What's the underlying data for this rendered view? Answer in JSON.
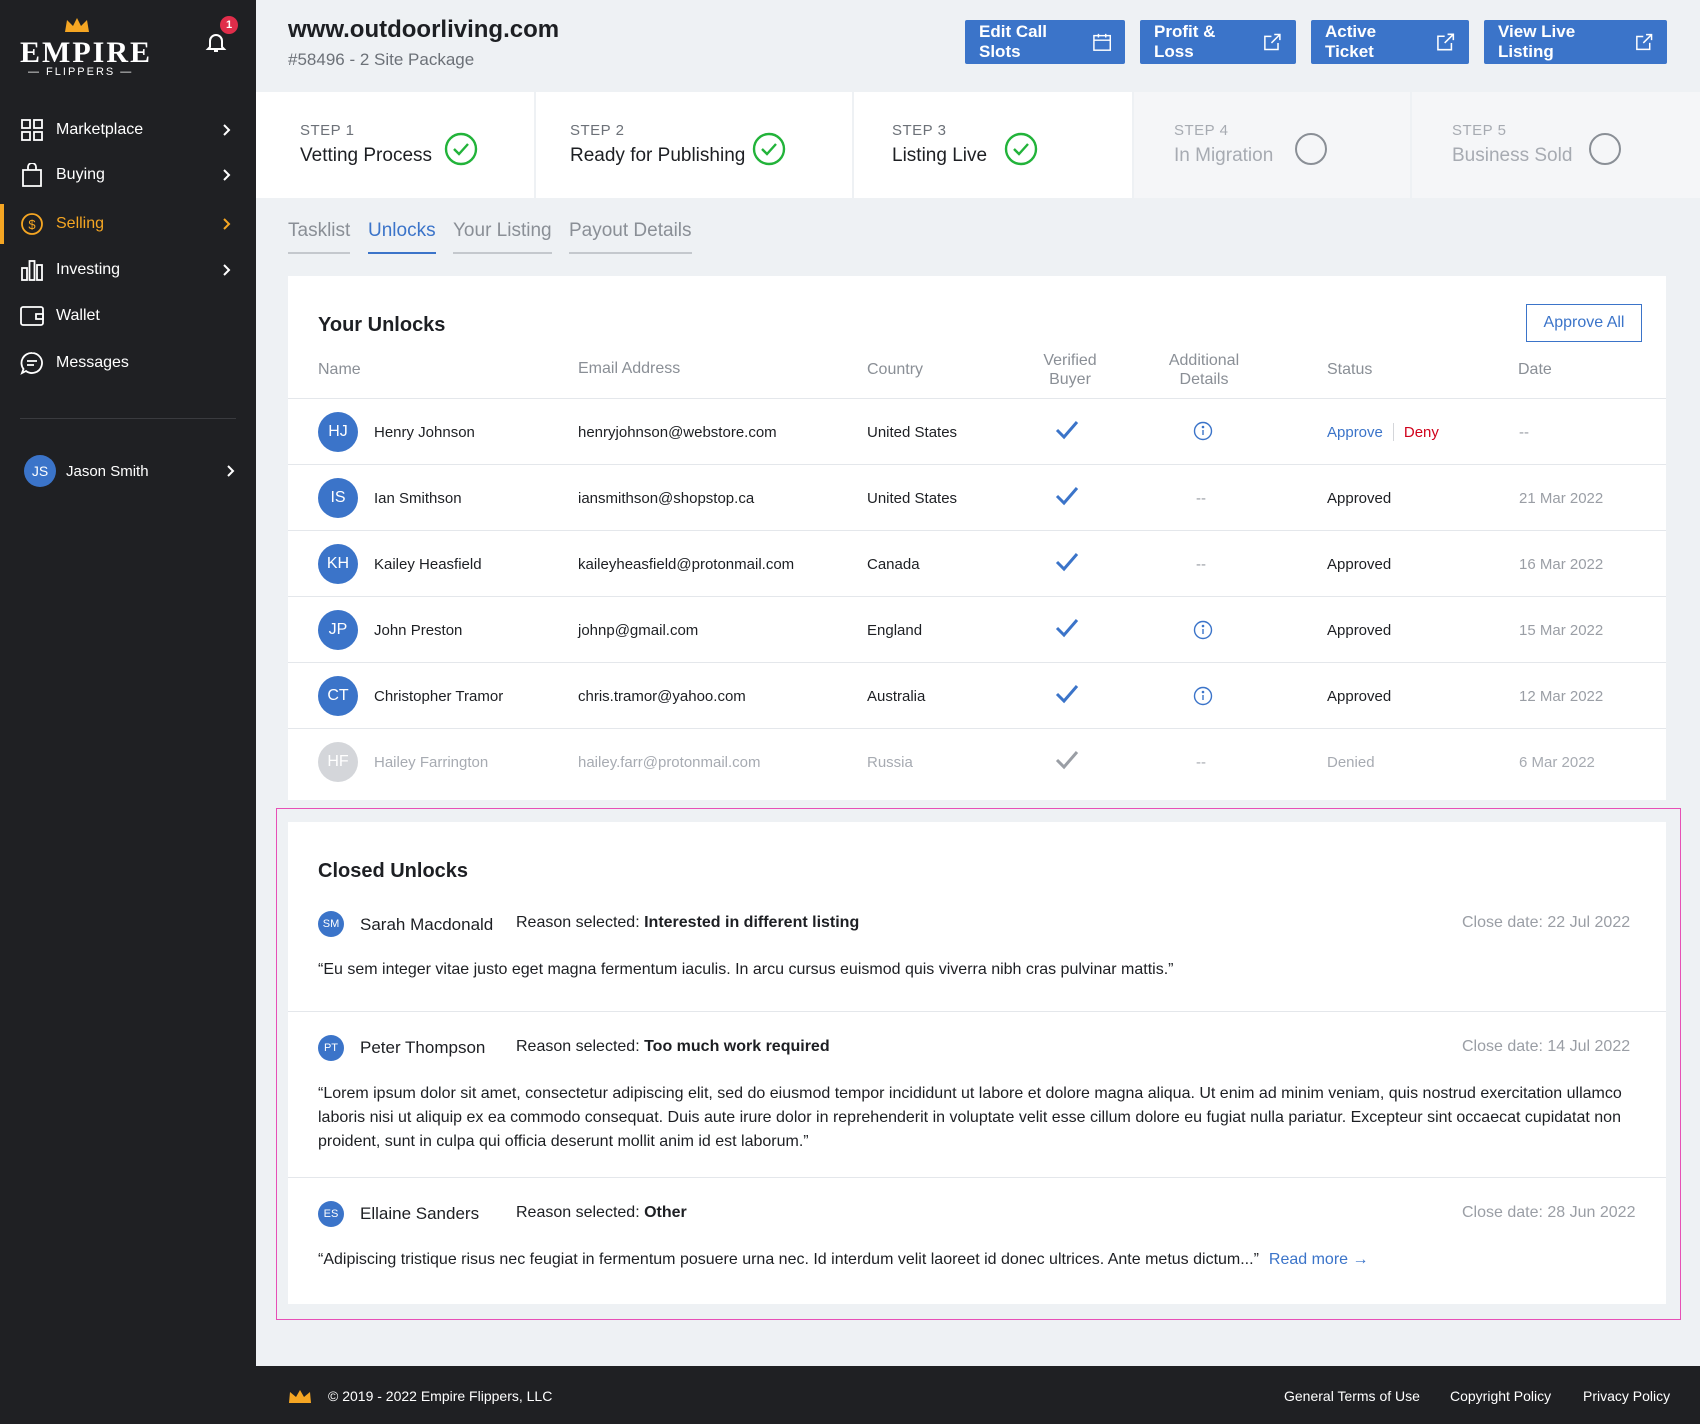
{
  "brand": {
    "name": "EMPIRE",
    "subname": "— FLIPPERS —",
    "notification_count": "1",
    "accent": "#f5a623",
    "primary": "#3b74c9"
  },
  "sidebar": {
    "items": [
      {
        "label": "Marketplace",
        "icon": "grid-icon"
      },
      {
        "label": "Buying",
        "icon": "shopping-bag-icon"
      },
      {
        "label": "Selling",
        "icon": "dollar-circle-icon"
      },
      {
        "label": "Investing",
        "icon": "bar-chart-icon"
      },
      {
        "label": "Wallet",
        "icon": "wallet-icon"
      },
      {
        "label": "Messages",
        "icon": "chat-icon"
      }
    ],
    "user": {
      "initials": "JS",
      "name": "Jason Smith"
    }
  },
  "header": {
    "title": "www.outdoorliving.com",
    "subtitle": "#58496 - 2 Site Package",
    "buttons": [
      "Edit Call Slots",
      "Profit & Loss",
      "Active Ticket",
      "View Live Listing"
    ]
  },
  "steps": [
    {
      "label": "STEP 1",
      "title": "Vetting Process",
      "done": true
    },
    {
      "label": "STEP 2",
      "title": "Ready for Publishing",
      "done": true
    },
    {
      "label": "STEP 3",
      "title": "Listing Live",
      "done": true
    },
    {
      "label": "STEP 4",
      "title": "In Migration",
      "done": false
    },
    {
      "label": "STEP 5",
      "title": "Business Sold",
      "done": false
    }
  ],
  "tabs": [
    "Tasklist",
    "Unlocks",
    "Your Listing",
    "Payout Details"
  ],
  "unlocks": {
    "title": "Your Unlocks",
    "approve_all": "Approve All",
    "columns": {
      "name": "Name",
      "email": "Email Address",
      "country": "Country",
      "verified_l1": "Verified",
      "verified_l2": "Buyer",
      "details_l1": "Additional",
      "details_l2": "Details",
      "status": "Status",
      "date": "Date"
    },
    "rows": [
      {
        "initials": "HJ",
        "name": "Henry Johnson",
        "email": "henryjohnson@webstore.com",
        "country": "United States",
        "details": "info",
        "status": "pending",
        "approve": "Approve",
        "deny": "Deny",
        "date": "--"
      },
      {
        "initials": "IS",
        "name": "Ian Smithson",
        "email": "iansmithson@shopstop.ca",
        "country": "United States",
        "details": "--",
        "status": "Approved",
        "date": "21 Mar 2022"
      },
      {
        "initials": "KH",
        "name": "Kailey Heasfield",
        "email": "kaileyheasfield@protonmail.com",
        "country": "Canada",
        "details": "--",
        "status": "Approved",
        "date": "16 Mar 2022"
      },
      {
        "initials": "JP",
        "name": "John Preston",
        "email": "johnp@gmail.com",
        "country": "England",
        "details": "info",
        "status": "Approved",
        "date": "15 Mar 2022"
      },
      {
        "initials": "CT",
        "name": "Christopher Tramor",
        "email": "chris.tramor@yahoo.com",
        "country": "Australia",
        "details": "info",
        "status": "Approved",
        "date": "12 Mar 2022"
      },
      {
        "initials": "HF",
        "name": "Hailey Farrington",
        "email": "hailey.farr@protonmail.com",
        "country": "Russia",
        "details": "--",
        "status": "Denied",
        "date": "6 Mar 2022"
      }
    ]
  },
  "closed": {
    "title": "Closed Unlocks",
    "reason_prefix": "Reason selected:",
    "entries": [
      {
        "initials": "SM",
        "name": "Sarah Macdonald",
        "reason": "Interested in different listing",
        "date": "Close date: 22 Jul 2022",
        "quote": "“Eu sem integer vitae justo eget magna fermentum iaculis. In arcu cursus euismod quis viverra nibh cras pulvinar mattis.”"
      },
      {
        "initials": "PT",
        "name": "Peter Thompson",
        "reason": "Too much work required",
        "date": "Close date: 14 Jul 2022",
        "quote": "“Lorem ipsum dolor sit amet, consectetur adipiscing elit, sed do eiusmod tempor incididunt ut labore et dolore magna aliqua. Ut enim ad minim veniam, quis nostrud exercitation ullamco laboris nisi ut aliquip ex ea commodo consequat. Duis aute irure dolor in reprehenderit in voluptate velit esse cillum dolore eu fugiat nulla pariatur. Excepteur sint occaecat cupidatat non proident, sunt in culpa qui officia deserunt mollit anim id est laborum.”"
      },
      {
        "initials": "ES",
        "name": "Ellaine Sanders",
        "reason": "Other",
        "date": "Close date: 28 Jun 2022",
        "quote": "“Adipiscing tristique risus nec feugiat in fermentum posuere urna nec. Id interdum velit laoreet id donec ultrices. Ante metus dictum...”",
        "read_more": "Read more →"
      }
    ]
  },
  "footer": {
    "copyright": "© 2019 - 2022 Empire Flippers, LLC",
    "links": [
      "General Terms of Use",
      "Copyright Policy",
      "Privacy Policy"
    ]
  }
}
